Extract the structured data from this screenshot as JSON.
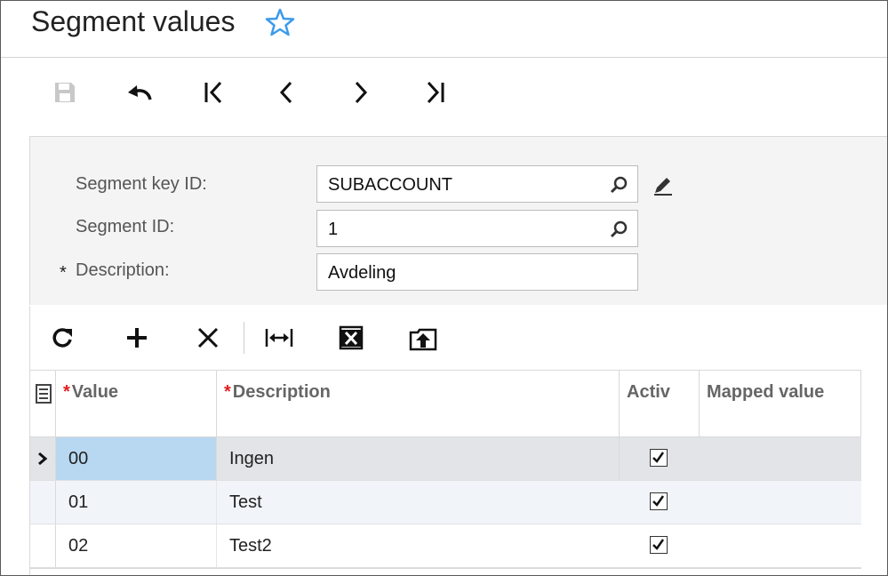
{
  "header": {
    "title": "Segment values"
  },
  "toolbar": {
    "buttons": [
      "save-icon",
      "undo-icon",
      "first-record-icon",
      "previous-record-icon",
      "next-record-icon",
      "last-record-icon"
    ]
  },
  "form": {
    "segment_key": {
      "label": "Segment key ID:",
      "value": "SUBACCOUNT"
    },
    "segment_id": {
      "label": "Segment ID:",
      "value": "1"
    },
    "description": {
      "required_mark": "*",
      "label": "Description:",
      "value": "Avdeling"
    }
  },
  "grid_toolbar": {
    "buttons": [
      "refresh-icon",
      "add-row-icon",
      "delete-row-icon",
      "fit-to-screen-icon",
      "export-excel-icon",
      "upload-icon"
    ]
  },
  "grid": {
    "columns": {
      "value": {
        "required_mark": "*",
        "label": "Value"
      },
      "description": {
        "required_mark": "*",
        "label": "Description"
      },
      "active": {
        "label": "Activ"
      },
      "mapped": {
        "label": "Mapped value"
      }
    },
    "rows": [
      {
        "value": "00",
        "description": "Ingen",
        "active": true
      },
      {
        "value": "01",
        "description": "Test",
        "active": true
      },
      {
        "value": "02",
        "description": "Test2",
        "active": true
      }
    ]
  },
  "colors": {
    "accent_star": "#3d9be9",
    "selected_cell": "#b8d8f1",
    "selected_row": "#e2e4e7",
    "alt_row": "#f1f5fa",
    "required_red": "#e02020"
  }
}
